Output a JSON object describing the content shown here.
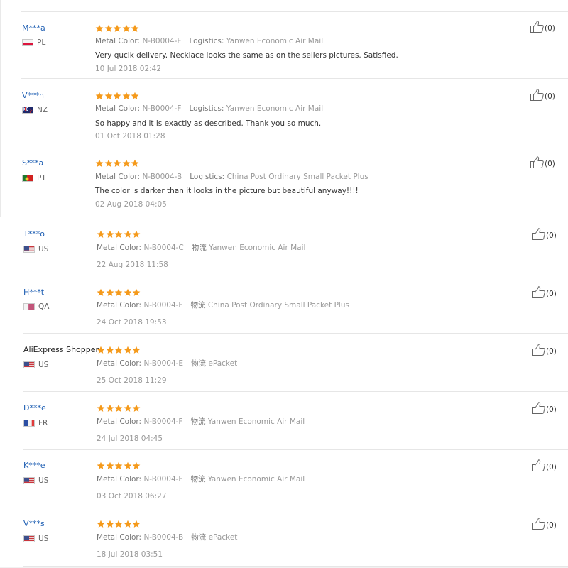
{
  "labels": {
    "metal_color": "Metal Color:",
    "logistics_en": "Logistics:",
    "logistics_cn": "物流"
  },
  "rating_icon": "star-icon",
  "colors": {
    "username": "#1f5fb3",
    "star": "#f59a1b",
    "divider": "#e6e6e6"
  },
  "reviews": [
    {
      "user": "M***a",
      "country": "PL",
      "rating": 5,
      "metal_color": "N-B0004-F",
      "logistics_label": "Logistics:",
      "logistics": "Yanwen Economic Air Mail",
      "text": "Very qucik delivery. Necklace looks the same as on the sellers pictures. Satisfied.",
      "date": "10 Jul 2018 02:42",
      "helpful": "(0)"
    },
    {
      "user": "V***h",
      "country": "NZ",
      "rating": 5,
      "metal_color": "N-B0004-F",
      "logistics_label": "Logistics:",
      "logistics": "Yanwen Economic Air Mail",
      "text": "So happy and it is exactly as described. Thank you so much.",
      "date": "01 Oct 2018 01:28",
      "helpful": "(0)"
    },
    {
      "user": "S***a",
      "country": "PT",
      "rating": 5,
      "metal_color": "N-B0004-B",
      "logistics_label": "Logistics:",
      "logistics": "China Post Ordinary Small Packet Plus",
      "text": "The color is darker than it looks in the picture but beautiful anyway!!!!",
      "date": "02 Aug 2018 04:05",
      "helpful": "(0)"
    },
    {
      "user": "T***o",
      "country": "US",
      "rating": 5,
      "metal_color": "N-B0004-C",
      "logistics_label": "物流",
      "logistics": "Yanwen Economic Air Mail",
      "text": "",
      "date": "22 Aug 2018 11:58",
      "helpful": "(0)"
    },
    {
      "user": "H***t",
      "country": "QA",
      "rating": 5,
      "metal_color": "N-B0004-F",
      "logistics_label": "物流",
      "logistics": "China Post Ordinary Small Packet Plus",
      "text": "",
      "date": "24 Oct 2018 19:53",
      "helpful": "(0)"
    },
    {
      "user": "AliExpress Shopper",
      "country": "US",
      "rating": 5,
      "metal_color": "N-B0004-E",
      "logistics_label": "物流",
      "logistics": "ePacket",
      "text": "",
      "date": "25 Oct 2018 11:29",
      "helpful": "(0)"
    },
    {
      "user": "D***e",
      "country": "FR",
      "rating": 5,
      "metal_color": "N-B0004-F",
      "logistics_label": "物流",
      "logistics": "Yanwen Economic Air Mail",
      "text": "",
      "date": "24 Jul 2018 04:45",
      "helpful": "(0)"
    },
    {
      "user": "K***e",
      "country": "US",
      "rating": 5,
      "metal_color": "N-B0004-F",
      "logistics_label": "物流",
      "logistics": "Yanwen Economic Air Mail",
      "text": "",
      "date": "03 Oct 2018 06:27",
      "helpful": "(0)"
    },
    {
      "user": "V***s",
      "country": "US",
      "rating": 5,
      "metal_color": "N-B0004-B",
      "logistics_label": "物流",
      "logistics": "ePacket",
      "text": "",
      "date": "18 Jul 2018 03:51",
      "helpful": "(0)"
    }
  ]
}
